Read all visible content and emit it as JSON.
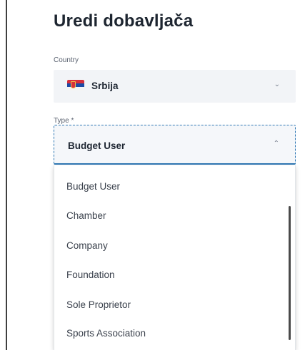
{
  "page": {
    "title": "Uredi dobavljača"
  },
  "country": {
    "label": "Country",
    "value": "Srbija",
    "flag_icon": "serbia-flag-icon",
    "chevron_icon": "chevron-down-icon"
  },
  "type": {
    "label": "Type *",
    "value": "Budget User",
    "chevron_icon": "chevron-up-icon",
    "focus_color": "#2f78b5"
  },
  "dropdown": {
    "options": [
      "Budget User",
      "Chamber",
      "Company",
      "Foundation",
      "Sole Proprietor",
      "Sports Association"
    ]
  }
}
